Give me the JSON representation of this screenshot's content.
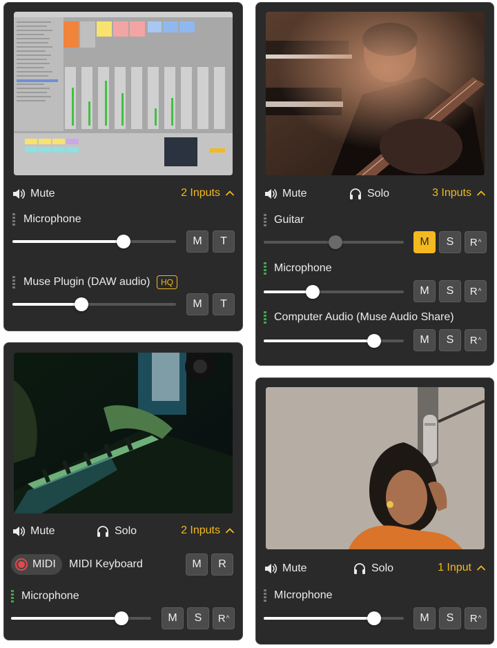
{
  "colors": {
    "accent": "#f3b91e",
    "panel": "#2a2a2a",
    "meter_active": "#3ea84b",
    "record": "#e0494d"
  },
  "icons": {
    "mute": "speaker-icon",
    "solo": "headphones-icon",
    "expand": "chevron-up-icon",
    "record": "record-icon"
  },
  "panels": {
    "a": {
      "mute_label": "Mute",
      "inputs_label": "2 Inputs",
      "tracks": [
        {
          "label": "Microphone",
          "level": 0.68,
          "buttons": [
            "M",
            "T"
          ]
        },
        {
          "label": "Muse Plugin (DAW audio)",
          "badge": "HQ",
          "level": 0.42,
          "buttons": [
            "M",
            "T"
          ]
        }
      ]
    },
    "b": {
      "mute_label": "Mute",
      "solo_label": "Solo",
      "inputs_label": "3 Inputs",
      "tracks": [
        {
          "label": "Guitar",
          "level": 0.51,
          "buttons": [
            "M",
            "S",
            "R"
          ]
        },
        {
          "label": "Microphone",
          "level": 0.35,
          "buttons": [
            "M",
            "S",
            "R"
          ]
        },
        {
          "label": "Computer Audio (Muse Audio Share)",
          "level": 0.79,
          "buttons": [
            "M",
            "S",
            "R"
          ]
        }
      ]
    },
    "c": {
      "mute_label": "Mute",
      "solo_label": "Solo",
      "inputs_label": "2 Inputs",
      "midi": {
        "pill_label": "MIDI",
        "device_label": "MIDI Keyboard",
        "buttons": [
          "M",
          "R"
        ]
      },
      "tracks": [
        {
          "label": "Microphone",
          "level": 0.79,
          "buttons": [
            "M",
            "S",
            "R"
          ]
        }
      ]
    },
    "d": {
      "mute_label": "Mute",
      "solo_label": "Solo",
      "inputs_label": "1 Input",
      "tracks": [
        {
          "label": "MIcrophone",
          "level": 0.79,
          "buttons": [
            "M",
            "S",
            "R"
          ]
        }
      ]
    }
  }
}
